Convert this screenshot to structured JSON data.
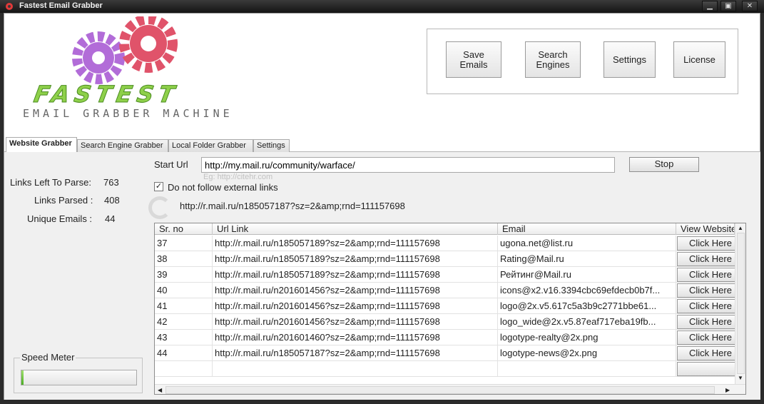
{
  "window": {
    "title": "Fastest Email Grabber",
    "minimize_icon": "minimize-icon",
    "maximize_icon": "maximize-icon",
    "close_icon": "close-icon"
  },
  "logo": {
    "word": "FASTEST",
    "subtitle": "EMAIL GRABBER MACHINE",
    "gear_colors": [
      "#b26cd8",
      "#e0536a"
    ]
  },
  "toolbar": {
    "save_emails": "Save\nEmails",
    "search_engines": "Search\nEngines",
    "settings": "Settings",
    "license": "License"
  },
  "tabs": [
    "Website Grabber",
    "Search Engine Grabber",
    "Local Folder Grabber",
    "Settings"
  ],
  "active_tab": "Website Grabber",
  "stats": {
    "links_left_label": "Links Left To Parse:",
    "links_left_value": "763",
    "links_parsed_label": "Links Parsed :",
    "links_parsed_value": "408",
    "unique_emails_label": "Unique Emails :",
    "unique_emails_value": "44"
  },
  "speed_meter": {
    "label": "Speed Meter",
    "level_fraction": 0.02
  },
  "form": {
    "start_url_label": "Start Url",
    "start_url_value": "http://my.mail.ru/community/warface/",
    "start_url_hint": "Eg: http://citehr.com",
    "stop_label": "Stop",
    "no_external_label": "Do not follow external links",
    "no_external_checked": true,
    "current_url": "http://r.mail.ru/n185057187?sz=2&amp;rnd=111157698"
  },
  "table": {
    "columns": [
      "Sr. no",
      "Url Link",
      "Email",
      "View Website"
    ],
    "button_label": "Click Here",
    "rows": [
      {
        "sr": "37",
        "url": "http://r.mail.ru/n185057189?sz=2&amp;rnd=111157698",
        "email": "ugona.net@list.ru"
      },
      {
        "sr": "38",
        "url": "http://r.mail.ru/n185057189?sz=2&amp;rnd=111157698",
        "email": "Rating@Mail.ru"
      },
      {
        "sr": "39",
        "url": "http://r.mail.ru/n185057189?sz=2&amp;rnd=111157698",
        "email": "Рейтинг@Mail.ru"
      },
      {
        "sr": "40",
        "url": "http://r.mail.ru/n201601456?sz=2&amp;rnd=111157698",
        "email": "icons@x2.v16.3394cbc69efdecb0b7f..."
      },
      {
        "sr": "41",
        "url": "http://r.mail.ru/n201601456?sz=2&amp;rnd=111157698",
        "email": "logo@2x.v5.617c5a3b9c2771bbe61..."
      },
      {
        "sr": "42",
        "url": "http://r.mail.ru/n201601456?sz=2&amp;rnd=111157698",
        "email": "logo_wide@2x.v5.87eaf717eba19fb..."
      },
      {
        "sr": "43",
        "url": "http://r.mail.ru/n201601460?sz=2&amp;rnd=111157698",
        "email": "logotype-realty@2x.png"
      },
      {
        "sr": "44",
        "url": "http://r.mail.ru/n185057187?sz=2&amp;rnd=111157698",
        "email": "logotype-news@2x.png"
      }
    ]
  }
}
